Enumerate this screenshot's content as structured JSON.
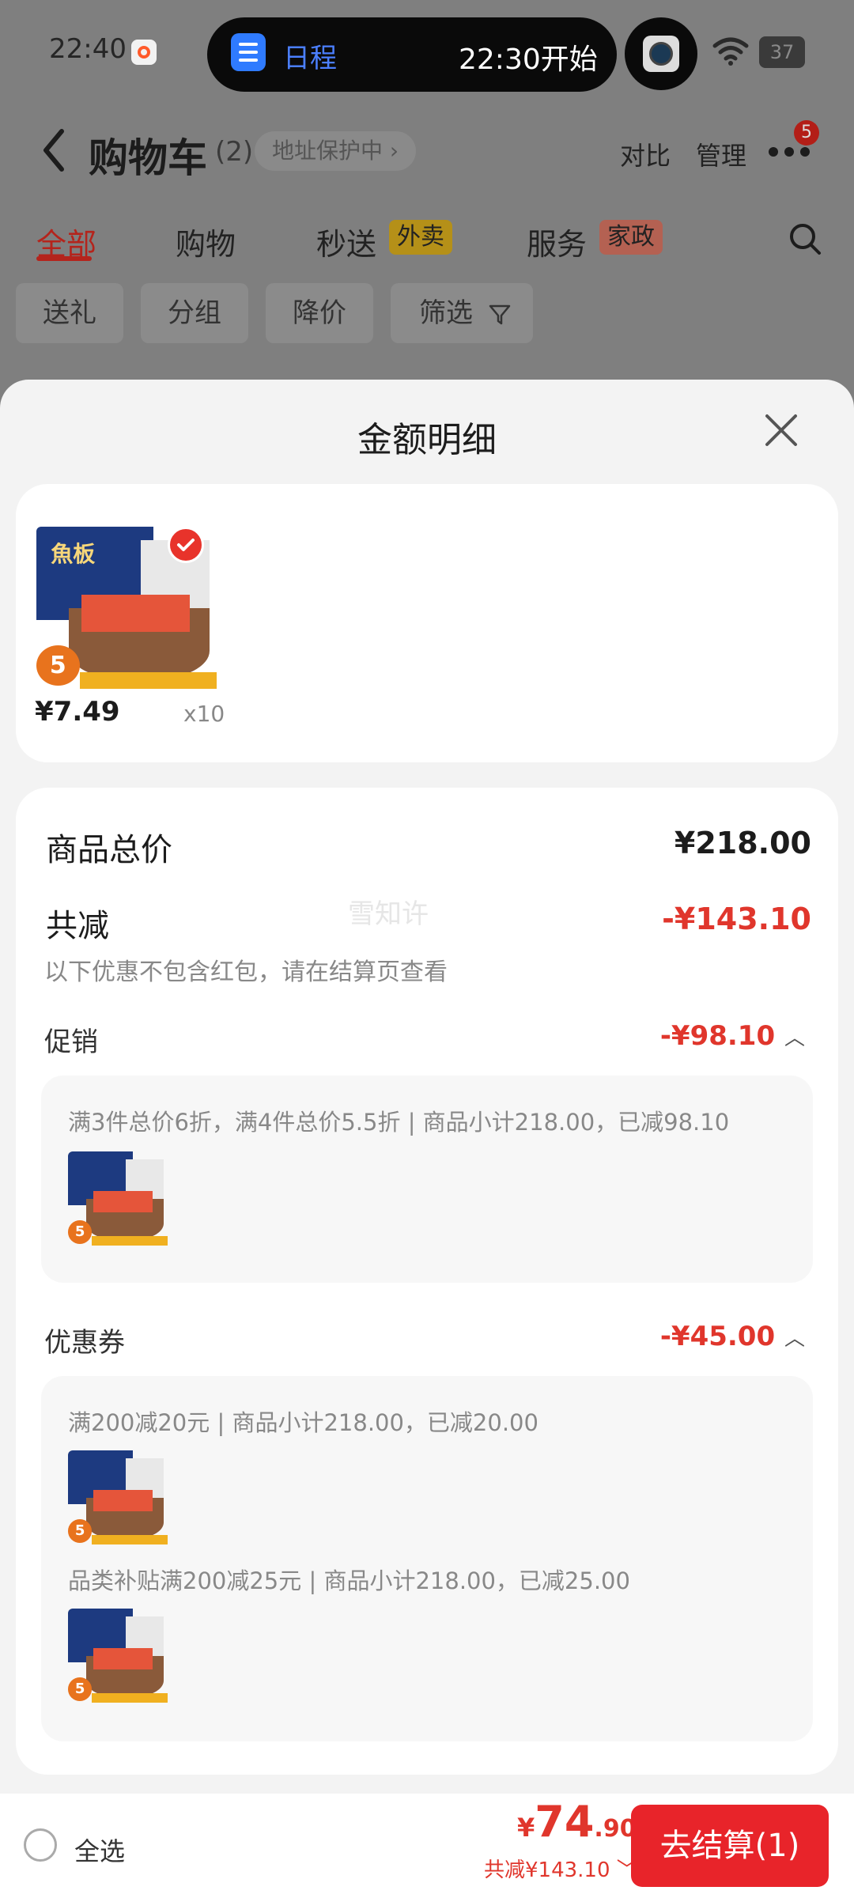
{
  "status_bar": {
    "time": "22:40",
    "island_title": "日程",
    "island_time": "22:30开始",
    "battery": "37"
  },
  "header": {
    "title": "购物车",
    "count": "(2)",
    "address_badge": "地址保护中",
    "compare": "对比",
    "manage": "管理",
    "more_badge": "5"
  },
  "tabs": [
    {
      "label": "全部"
    },
    {
      "label": "购物"
    },
    {
      "label": "秒送",
      "tag": "外卖"
    },
    {
      "label": "服务",
      "tag": "家政"
    }
  ],
  "chips": [
    "送礼",
    "分组",
    "降价",
    "筛选"
  ],
  "sheet": {
    "title": "金额明细",
    "product": {
      "brand": "魚板",
      "badge": "5",
      "price": "¥7.49",
      "qty": "x10"
    },
    "summary": {
      "total_label": "商品总价",
      "total_value": "¥218.00",
      "discount_label": "共减",
      "discount_value": "-¥143.10",
      "note": "以下优惠不包含红包，请在结算页查看",
      "watermark": "雪知许"
    },
    "promotion": {
      "label": "促销",
      "value": "-¥98.10",
      "detail": "满3件总价6折，满4件总价5.5折 | 商品小计218.00，已减98.10"
    },
    "coupon": {
      "label": "优惠券",
      "value": "-¥45.00",
      "detail_1": "满200减20元 | 商品小计218.00，已减20.00",
      "detail_2": "品类补贴满200减25元 | 商品小计218.00，已减25.00"
    }
  },
  "bottom_bar": {
    "select_all": "全选",
    "currency": "¥",
    "price_int": "74",
    "price_dec": ".90",
    "saved": "共减¥143.10",
    "checkout": "去结算(1)"
  }
}
